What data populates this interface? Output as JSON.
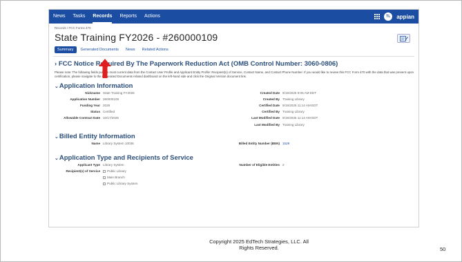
{
  "nav": {
    "items": [
      "News",
      "Tasks",
      "Records",
      "Reports",
      "Actions"
    ],
    "avatar_initials": "TL",
    "brand": "appian"
  },
  "header": {
    "breadcrumb": "Records / FCC Forms 470",
    "title": "State Training FY2026 - #260000109",
    "tabs": [
      "Summary",
      "Generated Documents",
      "News",
      "Related Actions"
    ]
  },
  "notice": {
    "heading": "FCC Notice Required By The Paperwork Reduction Act (OMB Control Number: 3060-0806)",
    "text": "Please note: The following fields pull the most current data from the Contact User Profile and Applicant Entity Profile: Recipient(s) of Service, Contact Name, and Contact Phone Number. If you would like to review this FCC Form 470 with the data that was present upon certification, please navigate to the Generated Documents related dashboard on the left-hand side and click the Original Version document link."
  },
  "application_info": {
    "heading": "Application Information",
    "left": [
      {
        "label": "Nickname",
        "value": "State Training FY2026"
      },
      {
        "label": "Application Number",
        "value": "260000109"
      },
      {
        "label": "Funding Year",
        "value": "2026"
      },
      {
        "label": "Status",
        "value": "Certified"
      },
      {
        "label": "Allowable Contract Date",
        "value": "10/17/2025"
      }
    ],
    "right": [
      {
        "label": "Created Date",
        "value": "9/19/2025 9:05 AM EDT"
      },
      {
        "label": "Created By",
        "value": "Training Library"
      },
      {
        "label": "Certified Date",
        "value": "9/19/2025 11:14 AM EDT"
      },
      {
        "label": "Certified By",
        "value": "Training Library"
      },
      {
        "label": "Last Modified Date",
        "value": "9/19/2025 11:14 AM EDT"
      },
      {
        "label": "Last Modified By",
        "value": "Training Library"
      }
    ]
  },
  "billed_entity": {
    "heading": "Billed Entity Information",
    "name_label": "Name",
    "name_value": "Library System 10036",
    "ben_label": "Billed Entity Number (BEN)",
    "ben_value": "1529"
  },
  "app_type": {
    "heading": "Application Type and Recipients of Service",
    "applicant_type_label": "Applicant Type",
    "applicant_type_value": "Library System",
    "recipients_label": "Recipient(s) of Service",
    "recipients": [
      "Public Library",
      "Main Branch",
      "Public Library System"
    ],
    "eligible_label": "Number of Eligible Entities",
    "eligible_value": "2"
  },
  "footer": {
    "copyright_line1": "Copyright 2025 EdTech Strategies, LLC.  All",
    "copyright_line2": "Rights Reserved.",
    "page_number": "50"
  },
  "colors": {
    "nav_bg": "#1b4ea3",
    "heading": "#2c4f7c",
    "arrow": "#e02020"
  }
}
